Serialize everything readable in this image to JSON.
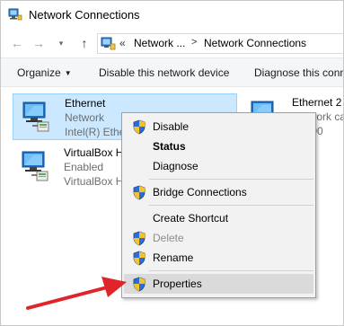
{
  "window": {
    "title": "Network Connections"
  },
  "address_bar": {
    "overflow_chevron": "«",
    "crumb_parent": "Network ...",
    "separator": ">",
    "crumb_current": "Network Connections"
  },
  "command_bar": {
    "organize_label": "Organize",
    "organize_caret": "▼",
    "disable_label": "Disable this network device",
    "diagnose_label": "Diagnose this conn"
  },
  "adapters": [
    {
      "name": "Ethernet",
      "status": "Network",
      "device": "Intel(R) Ethe",
      "icon": "network-adapter-icon",
      "selected": true
    },
    {
      "name": "VirtualBox H",
      "status": "Enabled",
      "device": "VirtualBox H",
      "icon": "network-adapter-icon",
      "selected": false
    },
    {
      "name": "Ethernet 2",
      "status": "Network ca",
      "device": "E2400",
      "icon": "network-adapter-icon",
      "selected": false
    }
  ],
  "context_menu": {
    "items": [
      {
        "label": "Disable",
        "icon": "uac-shield-icon",
        "bold": false,
        "disabled": false
      },
      {
        "label": "Status",
        "icon": "",
        "bold": true,
        "disabled": false
      },
      {
        "label": "Diagnose",
        "icon": "",
        "bold": false,
        "disabled": false
      },
      {
        "label": "Bridge Connections",
        "icon": "uac-shield-icon",
        "bold": false,
        "disabled": false
      },
      {
        "label": "Create Shortcut",
        "icon": "",
        "bold": false,
        "disabled": false
      },
      {
        "label": "Delete",
        "icon": "uac-shield-icon",
        "bold": false,
        "disabled": true
      },
      {
        "label": "Rename",
        "icon": "uac-shield-icon",
        "bold": false,
        "disabled": false
      },
      {
        "label": "Properties",
        "icon": "uac-shield-icon",
        "bold": false,
        "disabled": false,
        "highlighted": true
      }
    ]
  },
  "annotation": {
    "arrow_color": "#e0242a",
    "points_to": "Properties"
  },
  "colors": {
    "selection_fill": "#cce8ff",
    "selection_border": "#99d1ff",
    "menu_background": "#f2f2f2",
    "menu_hover": "#dadada"
  }
}
